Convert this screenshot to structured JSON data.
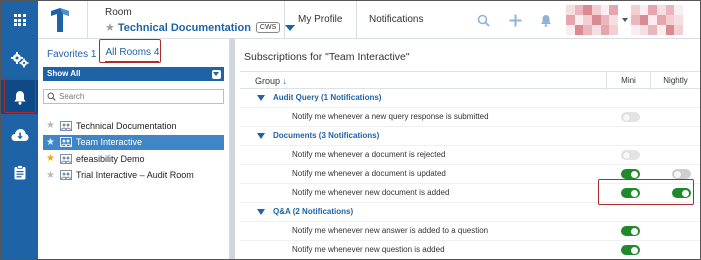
{
  "header": {
    "room_label": "Room",
    "room_name": "Technical Documentation",
    "room_badge": "CWS",
    "nav": [
      "My Profile",
      "Notifications"
    ],
    "icons": [
      "apps-grid-icon",
      "logo-icon",
      "search-icon",
      "plus-icon",
      "bell-icon"
    ],
    "avatar_colors": [
      "#e9b7bd",
      "#f3cfd3",
      "#d98a93",
      "#f6dfe2",
      "#e7a5ad",
      "#fbeef0"
    ]
  },
  "rail": {
    "items": [
      {
        "icon": "gears-icon",
        "active": false
      },
      {
        "icon": "bell-icon",
        "active": true
      },
      {
        "icon": "cloud-download-icon",
        "active": false
      },
      {
        "icon": "clipboard-icon",
        "active": false
      }
    ]
  },
  "rooms_panel": {
    "tabs": [
      {
        "label": "Favorites 1",
        "active": false
      },
      {
        "label": "All Rooms 4",
        "active": true
      }
    ],
    "filter": "Show All",
    "search_placeholder": "Search",
    "rooms": [
      {
        "name": "Technical Documentation",
        "favorite": false,
        "selected": false
      },
      {
        "name": "Team Interactive",
        "favorite": false,
        "selected": true
      },
      {
        "name": "efeasibility Demo",
        "favorite": true,
        "selected": false
      },
      {
        "name": "Trial Interactive – Audit Room",
        "favorite": false,
        "selected": false
      }
    ]
  },
  "main": {
    "title": "Subscriptions for \"Team Interactive\"",
    "columns": {
      "group": "Group",
      "sort_arrow": "↓",
      "mini": "Mini",
      "nightly": "Nightly"
    },
    "groups": [
      {
        "title": "Audit Query (1 Notifications)",
        "items": [
          {
            "text": "Notify me whenever a new query response is submitted",
            "mini": "off",
            "nightly": "none"
          }
        ]
      },
      {
        "title": "Documents (3 Notifications)",
        "items": [
          {
            "text": "Notify me whenever a document is rejected",
            "mini": "off",
            "nightly": "none"
          },
          {
            "text": "Notify me whenever a document is updated",
            "mini": "on",
            "nightly": "off-dark"
          },
          {
            "text": "Notify me whenever new document is added",
            "mini": "on",
            "nightly": "on"
          }
        ]
      },
      {
        "title": "Q&A (2 Notifications)",
        "items": [
          {
            "text": "Notify me whenever new answer is added to a question",
            "mini": "on",
            "nightly": "none"
          },
          {
            "text": "Notify me whenever new question is added",
            "mini": "on",
            "nightly": "none"
          }
        ]
      }
    ]
  },
  "colors": {
    "brand": "#1e63a6",
    "selected_row": "#3f86c8",
    "toggle_on": "#1f8a2c",
    "highlight": "#b02a2a",
    "favorite_star": "#f2a900"
  }
}
